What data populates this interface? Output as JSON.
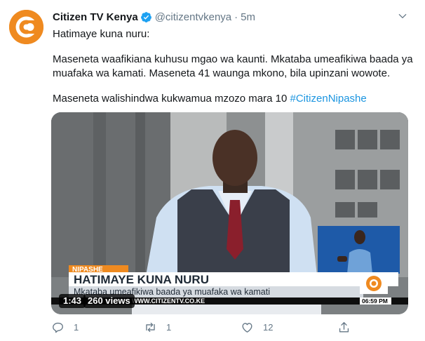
{
  "tweet": {
    "display_name": "Citizen TV Kenya",
    "handle": "@citizentvkenya",
    "separator": "·",
    "time": "5m",
    "lines": [
      "Hatimaye kuna nuru:",
      "Maseneta waafikiana kuhusu mgao wa kaunti. Mkataba umeafikiwa baada ya muafaka wa kamati. Maseneta 41 waunga mkono, bila upinzani wowote.",
      "Maseneta walishindwa kukwamua mzozo mara 10"
    ],
    "hashtag": "#CitizenNipashe"
  },
  "video": {
    "duration": "1:43",
    "views": "260 views",
    "tag": "NIPASHE",
    "headline": "HATIMAYE KUNA NURU",
    "subline": "Mkataba umeafikiwa baada ya muafaka wa kamati",
    "ticker_url": "WWW.CITIZENTV.CO.KE",
    "clock": "06:59 PM"
  },
  "actions": {
    "reply_count": "1",
    "retweet_count": "1",
    "like_count": "12"
  },
  "colors": {
    "brand_orange": "#ef8a20",
    "verified_blue": "#1da1f2",
    "hashtag": "#1b95e0",
    "muted": "#657786"
  },
  "icons": [
    "citizen-logo",
    "verified-badge-icon",
    "chevron-down-icon",
    "reply-icon",
    "retweet-icon",
    "like-icon",
    "share-icon"
  ]
}
